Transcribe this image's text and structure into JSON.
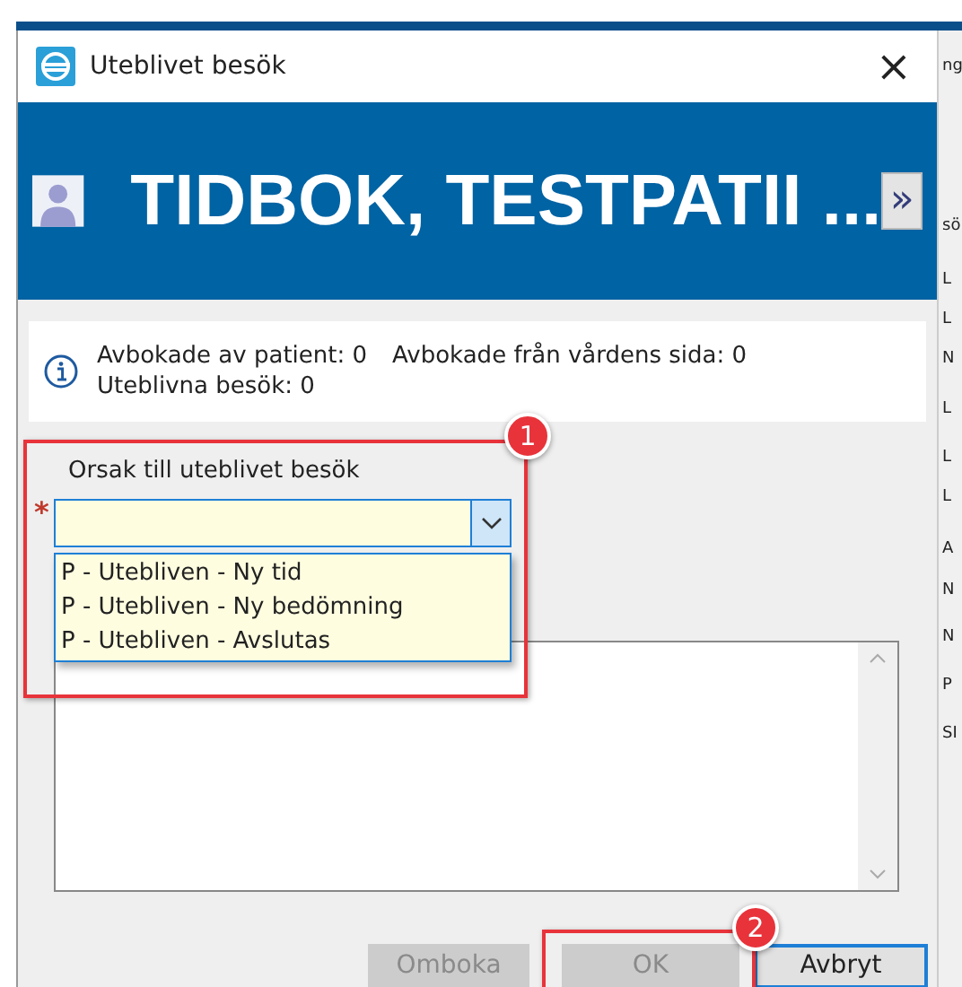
{
  "window": {
    "title": "Uteblivet besök",
    "close": "×"
  },
  "header": {
    "patient": "TIDBOK, TESTPATII ...",
    "expand": "»"
  },
  "info": {
    "lines": [
      "Avbokade av patient: 0",
      "Avbokade från vårdens sida: 0",
      "Uteblivna besök: 0"
    ]
  },
  "reason": {
    "label": "Orsak till uteblivet besök",
    "required": "*",
    "expanded": true,
    "options": [
      "P - Utebliven - Ny tid",
      "P - Utebliven - Ny bedömning",
      "P - Utebliven - Avslutas"
    ]
  },
  "comment": {
    "kind": "memo"
  },
  "buttons": [
    {
      "label": "Omboka",
      "disabled": true
    },
    {
      "label": "OK",
      "disabled": true
    },
    {
      "label": "Avbryt",
      "disabled": false
    }
  ],
  "callouts": [
    "1",
    "2"
  ],
  "background_window": {
    "row_fragments": [
      "ng",
      "sö",
      "L",
      "L",
      "N",
      "L",
      "L",
      "L",
      "A",
      "N",
      "N",
      "P",
      "SI"
    ]
  }
}
